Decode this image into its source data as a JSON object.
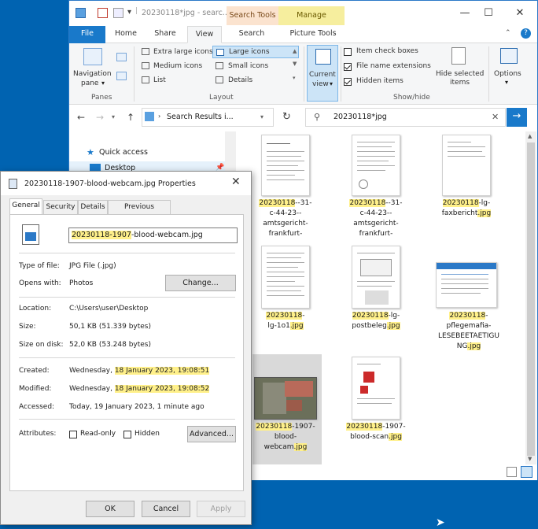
{
  "explorer": {
    "title": "20230118*jpg - searc...",
    "ctx_search_tools": "Search Tools",
    "ctx_manage": "Manage",
    "tabs": {
      "file": "File",
      "home": "Home",
      "share": "Share",
      "view": "View",
      "search": "Search",
      "picture_tools": "Picture Tools"
    },
    "ribbon": {
      "nav_pane": "Navigation\npane",
      "nav_pane_1": "Navigation",
      "nav_pane_2": "pane",
      "panes_group": "Panes",
      "extra_large": "Extra large icons",
      "large": "Large icons",
      "medium": "Medium icons",
      "small": "Small icons",
      "list": "List",
      "details": "Details",
      "layout_group": "Layout",
      "current_view_1": "Current",
      "current_view_2": "view",
      "item_check_boxes": "Item check boxes",
      "file_name_extensions": "File name extensions",
      "hidden_items": "Hidden items",
      "hide_selected_1": "Hide selected",
      "hide_selected_2": "items",
      "show_hide_group": "Show/hide",
      "options": "Options"
    },
    "address": "Search Results i...",
    "search_value": "20230118*jpg",
    "nav": {
      "quick_access": "Quick access",
      "desktop": "Desktop"
    },
    "files": [
      {
        "hl": "20230118",
        "rest": "--31-\nc-44-23--\namtsgericht-\nfrankfurt-"
      },
      {
        "hl": "20230118",
        "rest": "--31-\nc-44-23--\namtsgericht-\nfrankfurt-"
      },
      {
        "hl": "20230118",
        "rest": "-lg-\nfaxbericht",
        "ext": ".jpg"
      },
      {
        "hl": "20230118",
        "rest": "-\nlg-1o1",
        "ext": ".jpg"
      },
      {
        "hl": "20230118",
        "rest": "-lg-\npostbeleg",
        "ext": ".jpg"
      },
      {
        "hl": "20230118",
        "rest": "-\npflegemafia-\nLESEBEETAETIGU\nNG",
        "ext": ".jpg"
      },
      {
        "hl": "20230118",
        "rest": "-1907-\nblood-\nwebcam",
        "ext": ".jpg"
      },
      {
        "hl": "20230118",
        "rest": "-1907-\nblood-scan",
        "ext": ".jpg"
      }
    ]
  },
  "props": {
    "title": "20230118-1907-blood-webcam.jpg Properties",
    "tabs": [
      "General",
      "Security",
      "Details",
      "Previous Versions"
    ],
    "filename_hl": "20230118-1907",
    "filename_rest": "-blood-webcam.jpg",
    "type_label": "Type of file:",
    "type_value": "JPG File (.jpg)",
    "opens_label": "Opens with:",
    "opens_value": "Photos",
    "change_btn": "Change...",
    "location_label": "Location:",
    "location_value": "C:\\Users\\user\\Desktop",
    "size_label": "Size:",
    "size_value": "50,1 KB (51.339 bytes)",
    "size_disk_label": "Size on disk:",
    "size_disk_value": "52,0 KB (53.248 bytes)",
    "created_label": "Created:",
    "created_day": "Wednesday, ",
    "created_hl": "18 January 2023, 19:08:51",
    "modified_label": "Modified:",
    "modified_day": "Wednesday, ",
    "modified_hl": "18 January 2023, 19:08:52",
    "accessed_label": "Accessed:",
    "accessed_value": "Today, 19 January 2023, 1 minute ago",
    "attributes_label": "Attributes:",
    "readonly": "Read-only",
    "hidden": "Hidden",
    "advanced_btn": "Advanced...",
    "ok": "OK",
    "cancel": "Cancel",
    "apply": "Apply"
  }
}
